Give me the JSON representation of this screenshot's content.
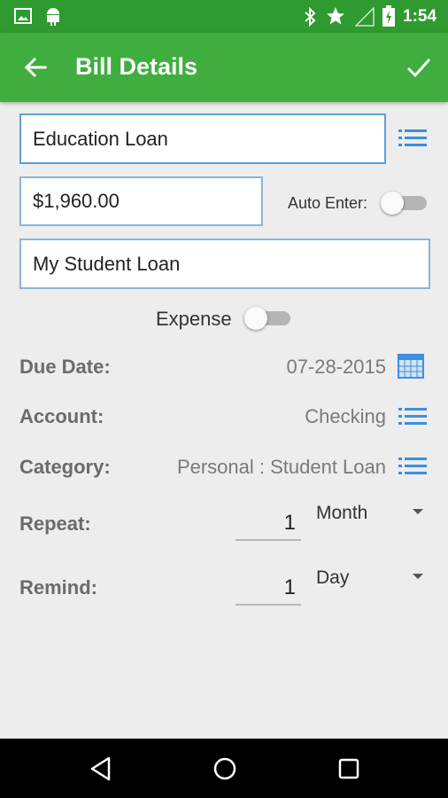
{
  "status_bar": {
    "time": "1:54"
  },
  "app_bar": {
    "title": "Bill Details"
  },
  "form": {
    "name_value": "Education Loan",
    "amount_value": "$1,960.00",
    "auto_enter_label": "Auto Enter:",
    "auto_enter_on": false,
    "note_value": "My Student Loan",
    "expense_label": "Expense",
    "expense_on": false,
    "due_date": {
      "label": "Due Date:",
      "value": "07-28-2015"
    },
    "account": {
      "label": "Account:",
      "value": "Checking"
    },
    "category": {
      "label": "Category:",
      "value": "Personal : Student Loan"
    },
    "repeat": {
      "label": "Repeat:",
      "number": "1",
      "unit": "Month"
    },
    "remind": {
      "label": "Remind:",
      "number": "1",
      "unit": "Day"
    }
  },
  "icons": {
    "back": "arrow-left-icon",
    "save": "check-icon",
    "list": "list-icon",
    "calendar": "calendar-icon"
  },
  "colors": {
    "status_bar": "#2e9a30",
    "app_bar": "#3fae3f",
    "accent_blue": "#3b8fde",
    "background": "#ededed"
  }
}
